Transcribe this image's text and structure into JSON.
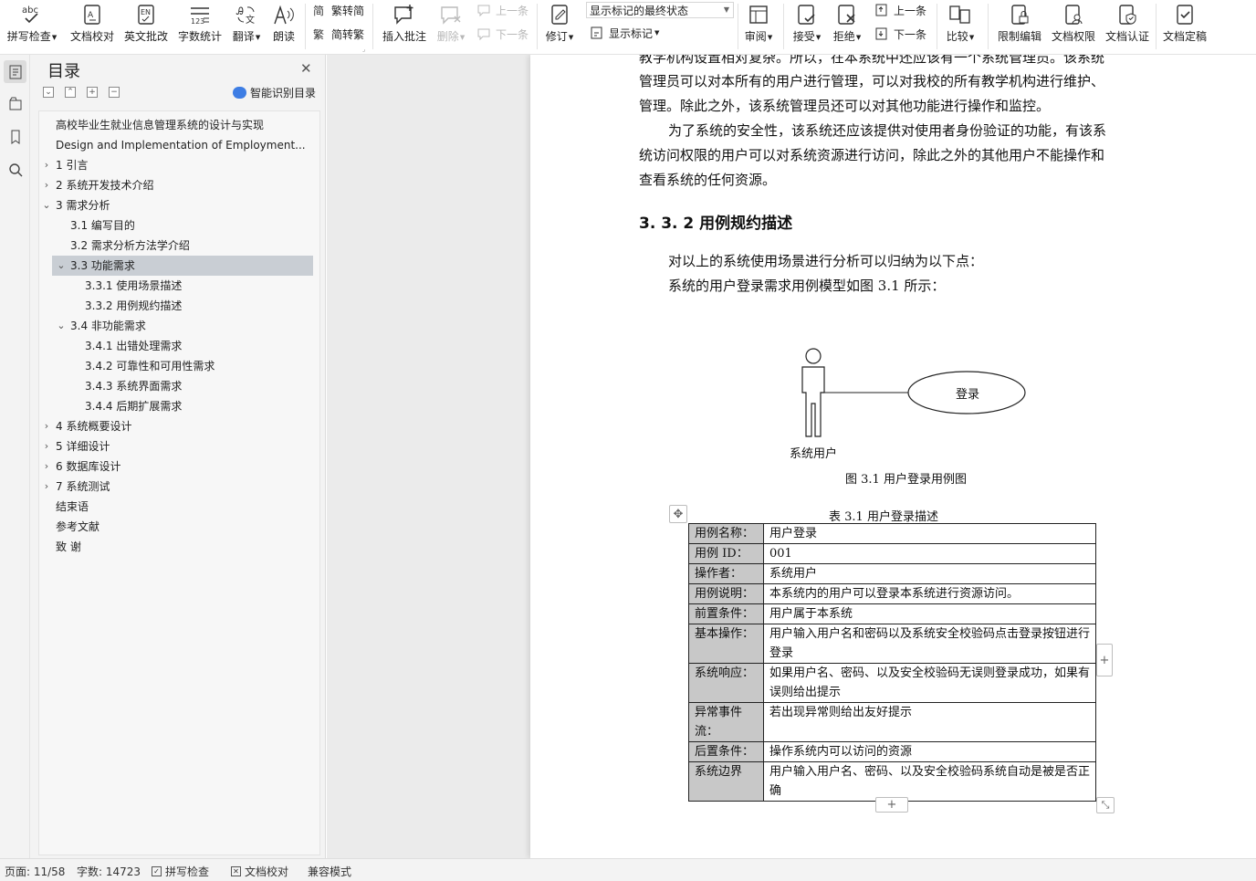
{
  "ribbon": {
    "spell_check": "拼写检查",
    "doc_proofread": "文档校对",
    "english_correct": "英文批改",
    "word_count": "字数统计",
    "translate": "翻译",
    "read_aloud": "朗读",
    "trad_to_simp": "繁转简",
    "simp_to_trad": "简转繁",
    "insert_comment": "插入批注",
    "delete": "删除",
    "prev_comment": "上一条",
    "next_comment": "下一条",
    "track_changes": "修订",
    "markup_state": "显示标记的最终状态",
    "show_markup": "显示标记",
    "review": "审阅",
    "accept": "接受",
    "reject": "拒绝",
    "prev_change": "上一条",
    "next_change": "下一条",
    "compare": "比较",
    "restrict_edit": "限制编辑",
    "doc_permission": "文档权限",
    "doc_certify": "文档认证",
    "doc_finalize": "文档定稿"
  },
  "toc": {
    "title": "目录",
    "smart_label": "智能识别目录",
    "items": [
      {
        "text": "高校毕业生就业信息管理系统的设计与实现",
        "level": 0,
        "caret": ""
      },
      {
        "text": "Design and Implementation of Employment...",
        "level": 0,
        "caret": ""
      },
      {
        "text": "1   引言",
        "level": 0,
        "caret": "›"
      },
      {
        "text": "2   系统开发技术介绍",
        "level": 0,
        "caret": "›"
      },
      {
        "text": "3     需求分析",
        "level": 0,
        "caret": "⌄"
      },
      {
        "text": "3.1  编写目的",
        "level": 1,
        "caret": ""
      },
      {
        "text": "3.2  需求分析方法学介绍",
        "level": 1,
        "caret": ""
      },
      {
        "text": "3.3 功能需求",
        "level": 1,
        "caret": "⌄",
        "selected": true
      },
      {
        "text": "3.3.1 使用场景描述",
        "level": 2,
        "caret": ""
      },
      {
        "text": "3.3.2 用例规约描述",
        "level": 2,
        "caret": ""
      },
      {
        "text": "3.4  非功能需求",
        "level": 1,
        "caret": "⌄"
      },
      {
        "text": "3.4.1  出错处理需求",
        "level": 2,
        "caret": ""
      },
      {
        "text": "3.4.2  可靠性和可用性需求",
        "level": 2,
        "caret": ""
      },
      {
        "text": "3.4.3  系统界面需求",
        "level": 2,
        "caret": ""
      },
      {
        "text": "3.4.4  后期扩展需求",
        "level": 2,
        "caret": ""
      },
      {
        "text": "4    系统概要设计",
        "level": 0,
        "caret": "›"
      },
      {
        "text": "5  详细设计",
        "level": 0,
        "caret": "›"
      },
      {
        "text": "6  数据库设计",
        "level": 0,
        "caret": "›"
      },
      {
        "text": "7  系统测试",
        "level": 0,
        "caret": "›"
      },
      {
        "text": "结束语",
        "level": 0,
        "caret": ""
      },
      {
        "text": "参考文献",
        "level": 0,
        "caret": ""
      },
      {
        "text": "致   谢",
        "level": 0,
        "caret": ""
      }
    ]
  },
  "document": {
    "line1": "教学机构设置相对复杂。所以，在本系统中还应该有一个系统管理员。该系统",
    "line2": "管理员可以对本所有的用户进行管理，可以对我校的所有教学机构进行维护、",
    "line3": "管理。除此之外，该系统管理员还可以对其他功能进行操作和监控。",
    "line4": "为了系统的安全性，该系统还应该提供对使用者身份验证的功能，有该系",
    "line5": "统访问权限的用户可以对系统资源进行访问，除此之外的其他用户不能操作和",
    "line6": "查看系统的任何资源。",
    "heading": "3. 3. 2 用例规约描述",
    "line7": "对以上的系统使用场景进行分析可以归纳为以下点：",
    "line8": "系统的用户登录需求用例模型如图  3.1  所示：",
    "diagram_actor": "系统用户",
    "diagram_usecase": "登录",
    "figure_caption": "图  3.1  用户登录用例图",
    "table_caption": "表  3.1  用户登录描述",
    "table_rows": [
      {
        "k": "用例名称：",
        "v": "用户登录"
      },
      {
        "k": "用例 ID：",
        "v": "001"
      },
      {
        "k": "操作者：",
        "v": "系统用户"
      },
      {
        "k": "用例说明：",
        "v": "本系统内的用户可以登录本系统进行资源访问。"
      },
      {
        "k": "前置条件：",
        "v": "用户属于本系统"
      },
      {
        "k": "基本操作：",
        "v": "用户输入用户名和密码以及系统安全校验码点击登录按钮进行登录"
      },
      {
        "k": "系统响应：",
        "v": "如果用户名、密码、以及安全校验码无误则登录成功，如果有误则给出提示"
      },
      {
        "k": "异常事件流：",
        "v": "若出现异常则给出友好提示"
      },
      {
        "k": "后置条件：",
        "v": "操作系统内可以访问的资源"
      },
      {
        "k": "系统边界",
        "v": "用户输入用户名、密码、以及安全校验码系统自动是被是否正确"
      }
    ]
  },
  "status": {
    "page": "页面: 11/58",
    "words": "字数: 14723",
    "spell": "拼写检查",
    "proof": "文档校对",
    "mode": "兼容模式"
  },
  "colors": {
    "toc_selected": "#c9ced4",
    "table_key_bg": "#c8c8c8",
    "accent": "#3d7de4"
  }
}
